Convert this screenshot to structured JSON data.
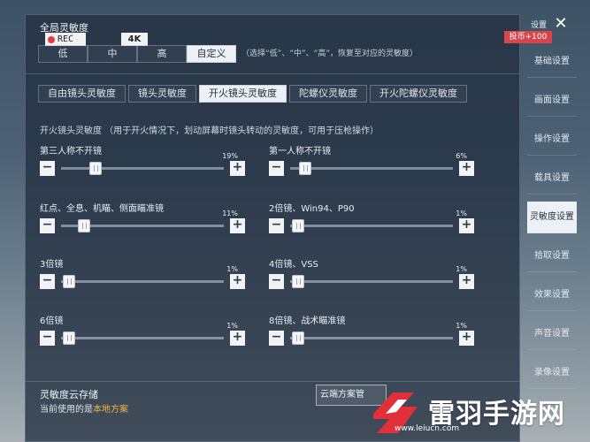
{
  "main": {
    "section_title": "全局灵敏度",
    "rec_label": "REC",
    "resolution_label": "4K",
    "presets": [
      "低",
      "中",
      "高",
      "自定义"
    ],
    "active_preset": 3,
    "preset_hint": "（选择“低”、“中”、“高”，恢复至对应的灵敏度）",
    "tabs": [
      "自由镜头灵敏度",
      "镜头灵敏度",
      "开火镜头灵敏度",
      "陀螺仪灵敏度",
      "开火陀螺仪灵敏度"
    ],
    "active_tab": 2,
    "tab_description": "开火镜头灵敏度 （用于开火情况下，划动屏幕时镜头转动的灵敏度，可用于压枪操作）",
    "sliders": [
      {
        "label": "第三人称不开镜",
        "value_text": "19%",
        "value": 19
      },
      {
        "label": "第一人称不开镜",
        "value_text": "6%",
        "value": 6
      },
      {
        "label": "红点、全息、机瞄、侧面瞄准镜",
        "value_text": "11%",
        "value": 11
      },
      {
        "label": "2倍镜、Win94、P90",
        "value_text": "1%",
        "value": 1
      },
      {
        "label": "3倍镜",
        "value_text": "1%",
        "value": 1
      },
      {
        "label": "4倍镜、VSS",
        "value_text": "1%",
        "value": 1
      },
      {
        "label": "6倍镜",
        "value_text": "1%",
        "value": 1
      },
      {
        "label": "8倍镜、战术瞄准镜",
        "value_text": "1%",
        "value": 1
      }
    ],
    "minus_label": "−",
    "plus_label": "+",
    "cloud_title": "灵敏度云存储",
    "cloud_sub_prefix": "当前使用的是",
    "cloud_sub_highlight": "本地方案",
    "cloud_button": "云端方案管"
  },
  "sidebar": {
    "top_label": "设置",
    "close_glyph": "✕",
    "badge": "投币+100",
    "items": [
      "基础设置",
      "画面设置",
      "操作设置",
      "载具设置",
      "灵敏度设置",
      "拾取设置",
      "效果设置",
      "声音设置",
      "录像设置"
    ],
    "active_index": 4
  },
  "watermark": {
    "name": "雷羽手游网",
    "url": "www.leiucn.com"
  },
  "colors": {
    "accent_red": "#d8454b",
    "highlight_orange": "#f1b640",
    "logo_red": "#e2303a"
  }
}
